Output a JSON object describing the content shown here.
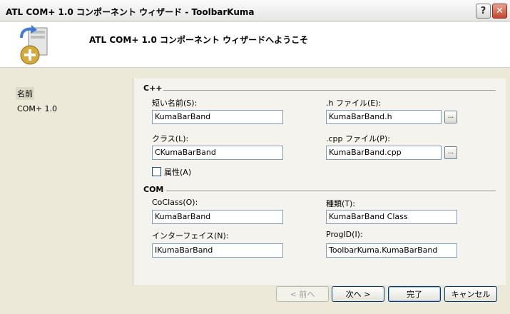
{
  "window": {
    "title": "ATL COM+ 1.0 コンポーネント ウィザード - ToolbarKuma",
    "help_label": "?",
    "close_label": "✕"
  },
  "header": {
    "heading": "ATL COM+ 1.0 コンポーネント ウィザードへようこそ",
    "icon": "wizard-add-icon"
  },
  "nav": {
    "items": [
      {
        "label": "名前",
        "selected": true
      },
      {
        "label": "COM+ 1.0",
        "selected": false
      }
    ]
  },
  "cpp_group": {
    "title": "C++",
    "short_name": {
      "label": "短い名前(S):",
      "value": "KumaBarBand"
    },
    "h_file": {
      "label": ".h ファイル(E):",
      "value": "KumaBarBand.h"
    },
    "class": {
      "label": "クラス(L):",
      "value": "CKumaBarBand"
    },
    "cpp_file": {
      "label": ".cpp ファイル(P):",
      "value": "KumaBarBand.cpp"
    },
    "attributed": {
      "label": "属性(A)",
      "checked": false
    },
    "browse_label": "..."
  },
  "com_group": {
    "title": "COM",
    "coclass": {
      "label": "CoClass(O):",
      "value": "KumaBarBand"
    },
    "type": {
      "label": "種類(T):",
      "value": "KumaBarBand Class"
    },
    "interface": {
      "label": "インターフェイス(N):",
      "value": "IKumaBarBand"
    },
    "progid": {
      "label": "ProgID(I):",
      "value": "ToolbarKuma.KumaBarBand"
    }
  },
  "buttons": {
    "back": "< 前へ",
    "next": "次へ >",
    "finish": "完了",
    "cancel": "キャンセル"
  }
}
